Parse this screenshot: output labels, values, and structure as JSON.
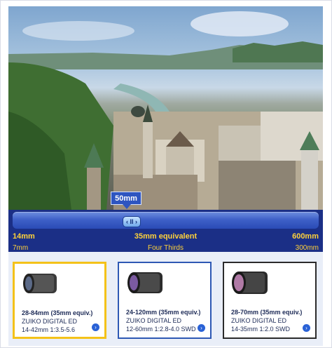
{
  "zoom": {
    "current_label": "50mm",
    "thumb_glyph": "‹ II ›",
    "labels_35mm": {
      "min": "14mm",
      "title": "35mm equivalent",
      "max": "600mm"
    },
    "labels_four_thirds": {
      "min": "7mm",
      "title": "Four Thirds",
      "max": "300mm"
    },
    "position_fraction": 0.39
  },
  "lenses": [
    {
      "title": "28-84mm (35mm equiv.)",
      "line2": "ZUIKO DIGITAL ED",
      "line3": "14-42mm 1:3.5-5.6",
      "icon": "arrow-right-icon"
    },
    {
      "title": "24-120mm (35mm equiv.)",
      "line2": "ZUIKO DIGITAL ED",
      "line3": "12-60mm 1:2.8-4.0 SWD",
      "icon": "arrow-right-icon"
    },
    {
      "title": "28-70mm (35mm equiv.)",
      "line2": "ZUIKO DIGITAL ED",
      "line3": "14-35mm 1:2.0 SWD",
      "icon": "arrow-right-icon"
    }
  ],
  "colors": {
    "accent_yellow": "#f4c21a",
    "bar_blue": "#1b2f86",
    "label_yellow": "#ffd23a"
  }
}
